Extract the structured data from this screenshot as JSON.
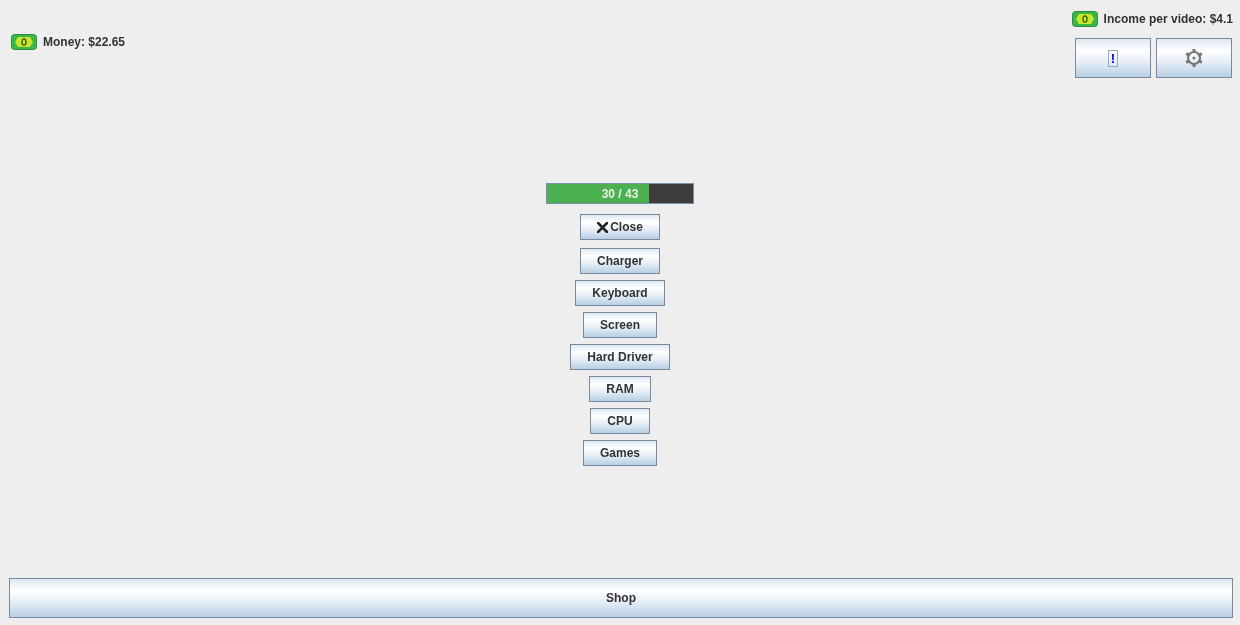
{
  "status": {
    "money": "Money: $22.65",
    "income": "Income per video: $4.1"
  },
  "toolbar": [
    {
      "kind": "alert",
      "label": "!",
      "focused": true
    },
    {
      "kind": "settings",
      "focused": false
    }
  ],
  "progress": {
    "level": 0.7,
    "text": "30 / 43"
  },
  "menu": [
    {
      "kind": "close",
      "label": "Close"
    },
    {
      "kind": "item",
      "label": "Charger"
    },
    {
      "kind": "item",
      "label": "Keyboard"
    },
    {
      "kind": "item",
      "label": "Screen"
    },
    {
      "kind": "item",
      "label": "Hard Driver"
    },
    {
      "kind": "item",
      "label": "RAM"
    },
    {
      "kind": "item",
      "label": "CPU"
    },
    {
      "kind": "item",
      "label": "Games"
    }
  ],
  "footer": {
    "button": "Shop"
  }
}
